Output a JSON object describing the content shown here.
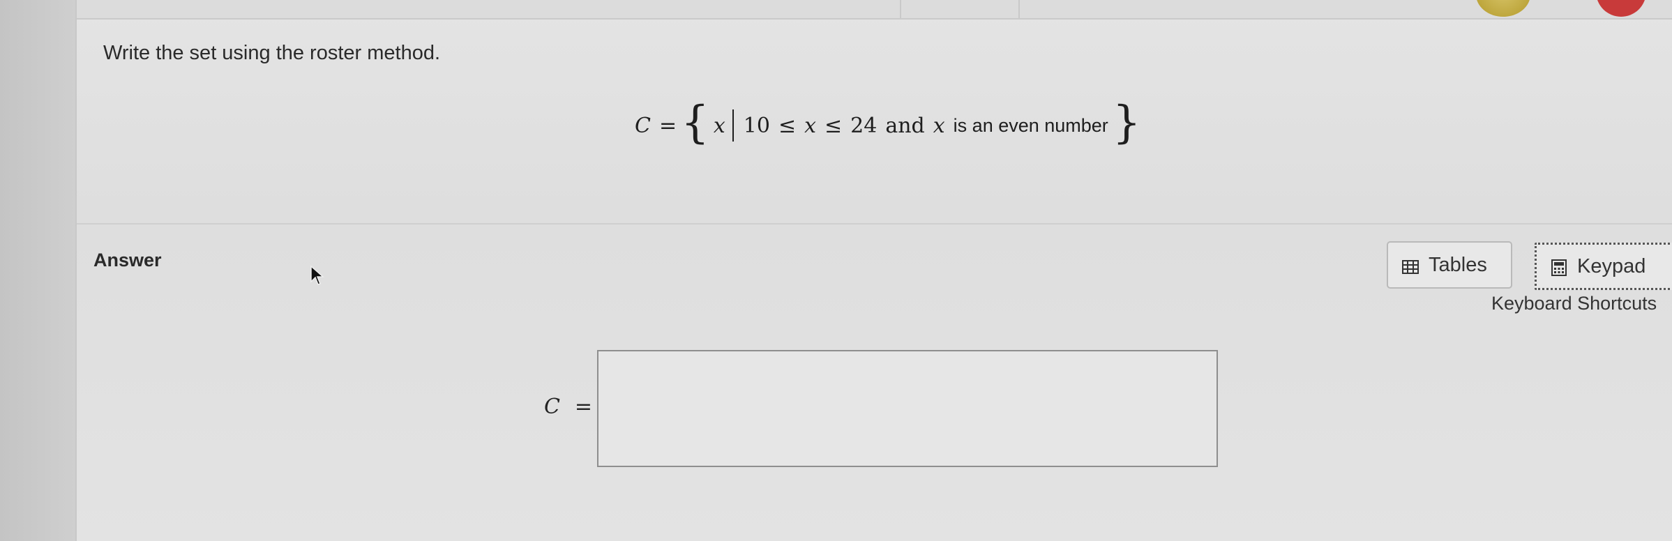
{
  "question": {
    "prompt": "Write the set using the roster method.",
    "set_name": "C",
    "equals": "=",
    "open_brace": "{",
    "variable": "x",
    "lower_bound": "10",
    "leq": "≤",
    "upper_bound": "24",
    "and_word": "and",
    "condition_text": "is an even number",
    "close_brace": "}"
  },
  "answer": {
    "heading": "Answer",
    "label": "C =",
    "value": ""
  },
  "toolbar": {
    "tables_label": "Tables",
    "keypad_label": "Keypad",
    "shortcuts_label": "Keyboard Shortcuts"
  },
  "icons": {
    "tables": "table-grid-icon",
    "keypad": "calculator-icon",
    "cursor": "mouse-pointer-icon"
  },
  "colors": {
    "panel_bg": "#e2e2e2",
    "text": "#222222",
    "box_border": "#8e8e8e",
    "keypad_outline": "#555555"
  }
}
